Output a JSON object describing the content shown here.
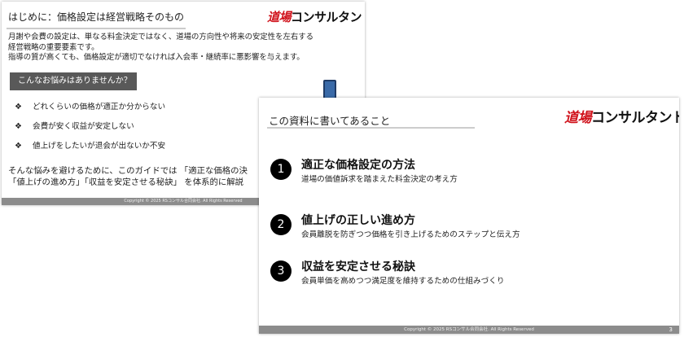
{
  "back_slide": {
    "title": "はじめに：価格設定は経営戦略そのもの",
    "brand": {
      "red": "道場",
      "black": "コンサルタント"
    },
    "intro_lines": [
      "月謝や会費の設定は、単なる料金決定ではなく、道場の方向性や将来の安定性を左右する",
      "経営戦略の重要要素です。",
      "指導の質が高くても、価格設定が適切でなければ入会率・継続率に悪影響を与えます。"
    ],
    "box_label": "こんなお悩みはありませんか？",
    "worry_mark": "❖",
    "worries": [
      "どれくらいの価格が適正か分からない",
      "会費が安く収益が安定しない",
      "値上げをしたいが退会が出ないか不安"
    ],
    "closing_lines": [
      "そんな悩みを避けるために、このガイドでは 「適正な価格の決",
      "「値上げの進め方」「収益を安定させる秘訣」 を体系的に解説"
    ],
    "footer": "Copyright © 2025 RSコンサル合同会社. All Rights Reserved"
  },
  "front_slide": {
    "title": "この資料に書いてあること",
    "brand": {
      "red": "道場",
      "black": "コンサルタント"
    },
    "items": [
      {
        "num": "1",
        "heading": "適正な価格設定の方法",
        "desc": "道場の価値訴求を踏まえた料金決定の考え方"
      },
      {
        "num": "2",
        "heading": "値上げの正しい進め方",
        "desc": "会員離脱を防ぎつつ価格を引き上げるためのステップと伝え方"
      },
      {
        "num": "3",
        "heading": "収益を安定させる秘訣",
        "desc": "会員単価を高めつつ満足度を維持するための仕組みづくり"
      }
    ],
    "footer": "Copyright © 2025 RSコンサル合同会社. All Rights Reserved",
    "page_number": "3"
  }
}
